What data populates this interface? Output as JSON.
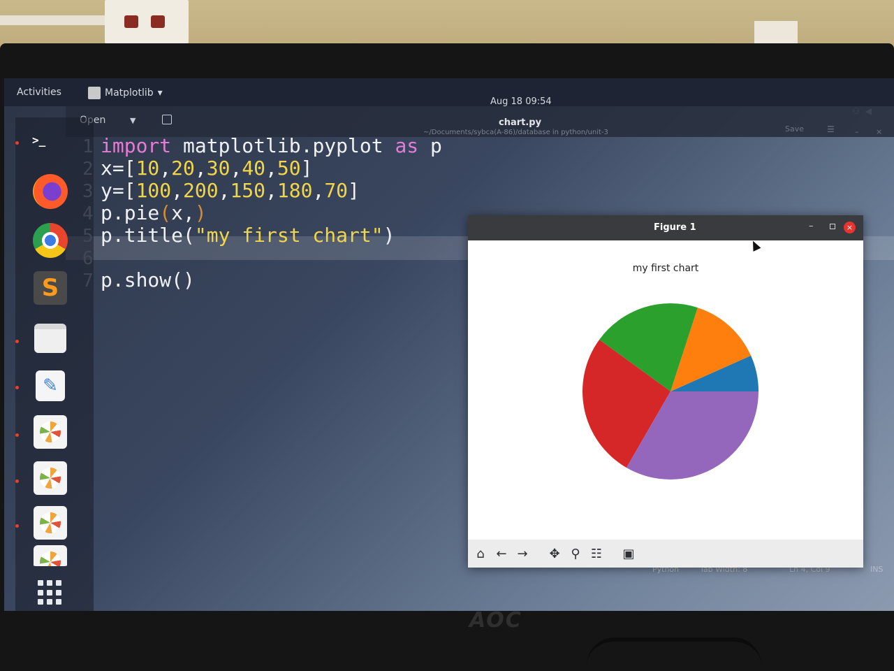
{
  "topbar": {
    "activities": "Activities",
    "app_name": "Matplotlib",
    "clock": "Aug 18 09:54"
  },
  "dock": {
    "items": [
      {
        "name": "terminal",
        "label": ">_"
      },
      {
        "name": "firefox"
      },
      {
        "name": "chrome"
      },
      {
        "name": "sublime-text",
        "label": "S"
      },
      {
        "name": "files"
      },
      {
        "name": "text-editor"
      },
      {
        "name": "matplotlib-figure-1"
      },
      {
        "name": "matplotlib-figure-2"
      },
      {
        "name": "matplotlib-figure-3"
      },
      {
        "name": "matplotlib-figure-4"
      },
      {
        "name": "show-applications"
      }
    ]
  },
  "editor": {
    "open_label": "Open",
    "filename": "chart.py",
    "path": "~/Documents/sybca(A-86)/database in python/unit-3",
    "save_label": "Save",
    "lines": [
      {
        "num": "1",
        "parts": [
          {
            "cls": "kw",
            "text": "import"
          },
          {
            "cls": "tx",
            "text": " matplotlib.pyplot "
          },
          {
            "cls": "kw",
            "text": "as"
          },
          {
            "cls": "tx",
            "text": " p"
          }
        ]
      },
      {
        "num": "2",
        "parts": [
          {
            "cls": "tx",
            "text": "x=["
          },
          {
            "cls": "num",
            "text": "10"
          },
          {
            "cls": "tx",
            "text": ","
          },
          {
            "cls": "num",
            "text": "20"
          },
          {
            "cls": "tx",
            "text": ","
          },
          {
            "cls": "num",
            "text": "30"
          },
          {
            "cls": "tx",
            "text": ","
          },
          {
            "cls": "num",
            "text": "40"
          },
          {
            "cls": "tx",
            "text": ","
          },
          {
            "cls": "num",
            "text": "50"
          },
          {
            "cls": "tx",
            "text": "]"
          }
        ]
      },
      {
        "num": "3",
        "parts": [
          {
            "cls": "tx",
            "text": "y=["
          },
          {
            "cls": "num",
            "text": "100"
          },
          {
            "cls": "tx",
            "text": ","
          },
          {
            "cls": "num",
            "text": "200"
          },
          {
            "cls": "tx",
            "text": ","
          },
          {
            "cls": "num",
            "text": "150"
          },
          {
            "cls": "tx",
            "text": ","
          },
          {
            "cls": "num",
            "text": "180"
          },
          {
            "cls": "tx",
            "text": ","
          },
          {
            "cls": "num",
            "text": "70"
          },
          {
            "cls": "tx",
            "text": "]"
          }
        ]
      },
      {
        "num": "4",
        "parts": [
          {
            "cls": "tx",
            "text": "p.pie"
          },
          {
            "cls": "dim",
            "text": "("
          },
          {
            "cls": "tx",
            "text": "x,"
          },
          {
            "cls": "dim",
            "text": ")"
          }
        ]
      },
      {
        "num": "5",
        "parts": [
          {
            "cls": "tx",
            "text": "p.title("
          },
          {
            "cls": "str",
            "text": "\"my first chart\""
          },
          {
            "cls": "tx",
            "text": ")"
          }
        ]
      },
      {
        "num": "6",
        "parts": []
      },
      {
        "num": "7",
        "parts": [
          {
            "cls": "tx",
            "text": "p.show()"
          }
        ]
      }
    ],
    "status": {
      "language": "Python",
      "tab_width": "Tab Width: 8",
      "position": "Ln 4, Col 9",
      "mode": "INS"
    }
  },
  "figure_window": {
    "title": "Figure 1"
  },
  "chart_data": {
    "type": "pie",
    "title": "my first chart",
    "values": [
      10,
      20,
      30,
      40,
      50
    ],
    "colors": [
      "#1f77b4",
      "#ff7f0e",
      "#2ca02c",
      "#d62728",
      "#9467bd"
    ],
    "start_angle_deg": 0,
    "direction": "counterclockwise"
  },
  "monitor": {
    "brand": "AOC"
  }
}
